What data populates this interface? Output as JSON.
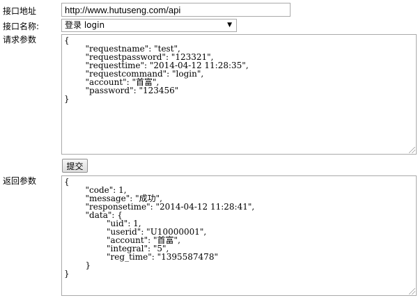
{
  "form": {
    "url_label": "接口地址",
    "url_value": "http://www.hutuseng.com/api",
    "name_label": "接口名称:",
    "name_selected": "登录 login",
    "request_label": "请求参数",
    "request_body": "{\n\t\"requestname\": \"test\",\n\t\"requestpassword\": \"123321\",\n\t\"requesttime\": \"2014-04-12 11:28:35\",\n\t\"requestcommand\": \"login\",\n\t\"account\": \"首富\",\n\t\"password\": \"123456\"\n}",
    "submit_label": "提交",
    "response_label": "返回参数",
    "response_body": "{\n\t\"code\": 1,\n\t\"message\": \"成功\",\n\t\"responsetime\": \"2014-04-12 11:28:41\",\n\t\"data\": {\n\t\t\"uid\": 1,\n\t\t\"userid\": \"U10000001\",\n\t\t\"account\": \"首富\",\n\t\t\"integral\": \"5\",\n\t\t\"reg_time\": \"1395587478\"\n\t}\n}"
  },
  "icons": {
    "dropdown": "chevron-down-icon",
    "resize": "resize-grip-icon"
  }
}
